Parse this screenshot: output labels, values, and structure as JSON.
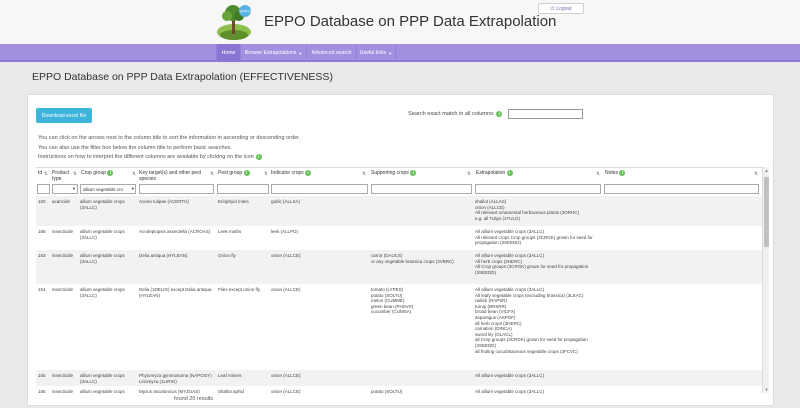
{
  "header": {
    "logo_text": "EPPO",
    "title": "EPPO Database on PPP Data Extrapolation",
    "logout_label": "Logout"
  },
  "nav": {
    "items": [
      {
        "label": "Home"
      },
      {
        "label": "Browse Extrapolations"
      },
      {
        "label": "Advanced search"
      },
      {
        "label": "Useful links"
      }
    ]
  },
  "page": {
    "title": "EPPO Database on PPP Data Extrapolation (EFFECTIVENESS)",
    "download_label": "Download excel file",
    "exact_match_label": "Search exact match in all columns:",
    "info_lines": [
      "You can click on the arrows next to the column title to sort the information in ascending or descending order.",
      "You can also use the filter box below the column title to perform basic searches.",
      "Instructions on how to interpret the different columns are available by clicking on the icon"
    ],
    "found_text": "found 20 results"
  },
  "table": {
    "headers": [
      "Id",
      "Product type",
      "Crop group",
      "Key target(s) and other pest species",
      "Pest group",
      "Indicator crops",
      "Supporting crops",
      "Extrapolation",
      "Notes"
    ],
    "crop_group_filter": "allium vegetable cro",
    "rows": [
      {
        "id": "160",
        "product_type": "acaricide",
        "crop_group": [
          "allium vegetable crops",
          "(3ALLC)"
        ],
        "key_target": [
          "Aceria tulipae (ACERTU)"
        ],
        "pest_group": [
          "Eriophyid mites"
        ],
        "indicator": [
          "garlic (ALLSA)"
        ],
        "supporting": [],
        "extrapolation": [
          "shallot (ALLAS)",
          "onion (ALLCE)",
          "All relevant ornamental herbaceous plants (3ORHC)",
          "e.g. all Tulips (1TULG)"
        ]
      },
      {
        "id": "166",
        "product_type": "insecticide",
        "crop_group": [
          "allium vegetable crops",
          "(3ALLC)"
        ],
        "key_target": [
          "Acrolepiopsis assectella (ACROAS)"
        ],
        "pest_group": [
          "Leek moths"
        ],
        "indicator": [
          "leek (ALLPO)"
        ],
        "supporting": [],
        "extrapolation": [
          "All allium vegetable crops (3ALLC)",
          "All relevant crops Crop groups (3CRGK) grown for seed for",
          "propagation (3SEEDD)"
        ]
      },
      {
        "id": "153",
        "product_type": "insecticide",
        "crop_group": [
          "allium vegetable crops",
          "(3ALLC)"
        ],
        "key_target": [
          "Delia antiqua (HYLEAN)"
        ],
        "pest_group": [
          "Onion fly"
        ],
        "indicator": [
          "onion (ALLCE)"
        ],
        "supporting": [
          "carrot (DAUCS)",
          "or any vegetable brassica crops (3VBRC)"
        ],
        "extrapolation": [
          "All allium vegetable crops (3ALLC)",
          "All herb crops (3HERC)",
          "All Crop groups (3CRGK) grown for seed for propagation",
          "(3SEEDD)"
        ]
      },
      {
        "id": "154",
        "product_type": "insecticide",
        "crop_group": [
          "allium vegetable crops",
          "(3ALLC)"
        ],
        "key_target": [
          "Delia (1DELIG) except Delia antiqua",
          "(HYLEAN)"
        ],
        "pest_group": [
          "Flies except onion fly"
        ],
        "indicator": [
          "onion (ALLCE)"
        ],
        "supporting": [
          "tomato (LYPES)",
          "potato (SOLTU)",
          "melon (CUMME)",
          "green bean (PHSVX)",
          "cucumber (CUMSA)"
        ],
        "extrapolation": [
          "All allium vegetable crops (3ALLC)",
          "All leafy vegetable crops (excluding brassica) (3LEAC)",
          "radish (RAPSR)",
          "turnip (BRSRR)",
          "broad bean (VICFX)",
          "asparagus (ASPOF)",
          "all herb crops (3HERC)",
          "carnation (DINCA)",
          "sword lily (GLACL)",
          "all Crop groups (3CRGK) grown for seed for propagation",
          "(3SEEDD)",
          "all fruiting cucurbitaceous vegetable crops (3FCVC)"
        ]
      },
      {
        "id": "155",
        "product_type": "insecticide",
        "crop_group": [
          "allium vegetable crops",
          "(3ALLC)"
        ],
        "key_target": [
          "Phytomyza gymnostoma (NAPOGY)",
          "Liriomyza (1LIRIG)"
        ],
        "pest_group": [
          "Leaf miners"
        ],
        "indicator": [
          "onion (ALLCE)"
        ],
        "supporting": [],
        "extrapolation": [
          "All allium vegetable crops (3ALLC)"
        ]
      },
      {
        "id": "156",
        "product_type": "insecticide",
        "crop_group": [
          "allium vegetable crops"
        ],
        "key_target": [
          "Myzus ascalonicus (MYZUAS)"
        ],
        "pest_group": [
          "Shallot aphid"
        ],
        "indicator": [
          "onion (ALLCE)"
        ],
        "supporting": [
          "potato (SOLTU)"
        ],
        "extrapolation": [
          "All allium vegetable crops (3ALLC)"
        ]
      }
    ]
  }
}
